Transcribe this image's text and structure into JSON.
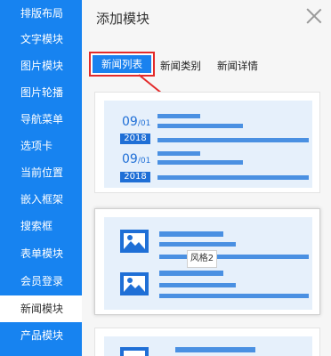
{
  "sidebar": {
    "items": [
      {
        "label": "排版布局"
      },
      {
        "label": "文字模块"
      },
      {
        "label": "图片模块"
      },
      {
        "label": "图片轮播"
      },
      {
        "label": "导航菜单"
      },
      {
        "label": "选项卡"
      },
      {
        "label": "当前位置"
      },
      {
        "label": "嵌入框架"
      },
      {
        "label": "搜索框"
      },
      {
        "label": "表单模块"
      },
      {
        "label": "会员登录"
      },
      {
        "label": "新闻模块"
      },
      {
        "label": "产品模块"
      }
    ],
    "active_index": 11
  },
  "panel": {
    "title": "添加模块",
    "tabs": [
      {
        "label": "新闻列表"
      },
      {
        "label": "新闻类别"
      },
      {
        "label": "新闻详情"
      }
    ],
    "cards": [
      {
        "dates": [
          {
            "month": "09",
            "day": "01",
            "year": "2018"
          },
          {
            "month": "09",
            "day": "01",
            "year": "2018"
          }
        ]
      },
      {
        "tooltip": "风格2"
      },
      {}
    ]
  },
  "colors": {
    "sidebar_bg": "#1783f0",
    "accent": "#1a82ef",
    "highlight_border": "#e32b2b",
    "thumb_bg": "#e6f0fb",
    "bar": "#4a90e2"
  },
  "icons": [
    "close-icon",
    "image-icon",
    "arrow-pointer"
  ]
}
